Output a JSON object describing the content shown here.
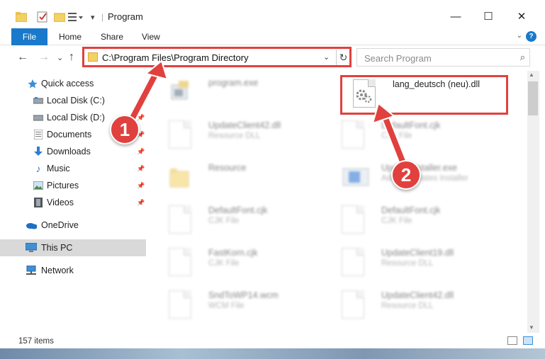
{
  "window": {
    "title": "Program",
    "minimize_glyph": "—",
    "maximize_glyph": "☐",
    "close_glyph": "✕"
  },
  "ribbon": {
    "tabs": [
      "File",
      "Home",
      "Share",
      "View"
    ],
    "collapse_glyph": "⌄",
    "help_glyph": "?"
  },
  "nav": {
    "back_glyph": "←",
    "forward_glyph": "→",
    "recent_glyph": "⌄",
    "up_glyph": "↑",
    "address": "C:\\Program Files\\Program Directory",
    "dropdown_glyph": "⌄",
    "refresh_glyph": "↻",
    "search_placeholder": "Search Program",
    "search_glyph": "⌕"
  },
  "sidebar": {
    "items": [
      {
        "label": "Quick access",
        "icon": "star-icon"
      },
      {
        "label": "Local Disk (C:)",
        "icon": "drive-icon"
      },
      {
        "label": "Local Disk (D:)",
        "icon": "drive-icon"
      },
      {
        "label": "Documents",
        "icon": "documents-icon"
      },
      {
        "label": "Downloads",
        "icon": "download-icon"
      },
      {
        "label": "Music",
        "icon": "music-icon"
      },
      {
        "label": "Pictures",
        "icon": "pictures-icon"
      },
      {
        "label": "Videos",
        "icon": "videos-icon"
      },
      {
        "label": "OneDrive",
        "icon": "cloud-icon"
      },
      {
        "label": "This PC",
        "icon": "computer-icon"
      },
      {
        "label": "Network",
        "icon": "network-icon"
      }
    ],
    "pin_glyph": "📌"
  },
  "files": [
    {
      "name": "program.exe",
      "type": ""
    },
    {
      "name": "lang_deutsch (neu).dll",
      "type": ""
    },
    {
      "name": "UpdateClient42.dll",
      "type": "Resource DLL"
    },
    {
      "name": "DefaultFont.cjk",
      "type": "CJK File"
    },
    {
      "name": "Resource",
      "type": ""
    },
    {
      "name": "UpdateInstaller.exe",
      "type": "Adobe Updates Installer"
    },
    {
      "name": "DefaultFont.cjk",
      "type": "CJK File"
    },
    {
      "name": "DefaultFont.cjk",
      "type": "CJK File"
    },
    {
      "name": "FastKorn.cjk",
      "type": "CJK File"
    },
    {
      "name": "UpdateClient19.dll",
      "type": "Resource DLL"
    },
    {
      "name": "SndToWP14.wcm",
      "type": "WCM File"
    },
    {
      "name": "UpdateClient42.dll",
      "type": "Resource DLL"
    }
  ],
  "status": {
    "count": "157 items"
  },
  "annotations": {
    "step1": "1",
    "step2": "2",
    "color": "#e0413e"
  },
  "colors": {
    "accent": "#1979ca",
    "highlight": "#e0413e",
    "selected": "#d9d9d9"
  }
}
